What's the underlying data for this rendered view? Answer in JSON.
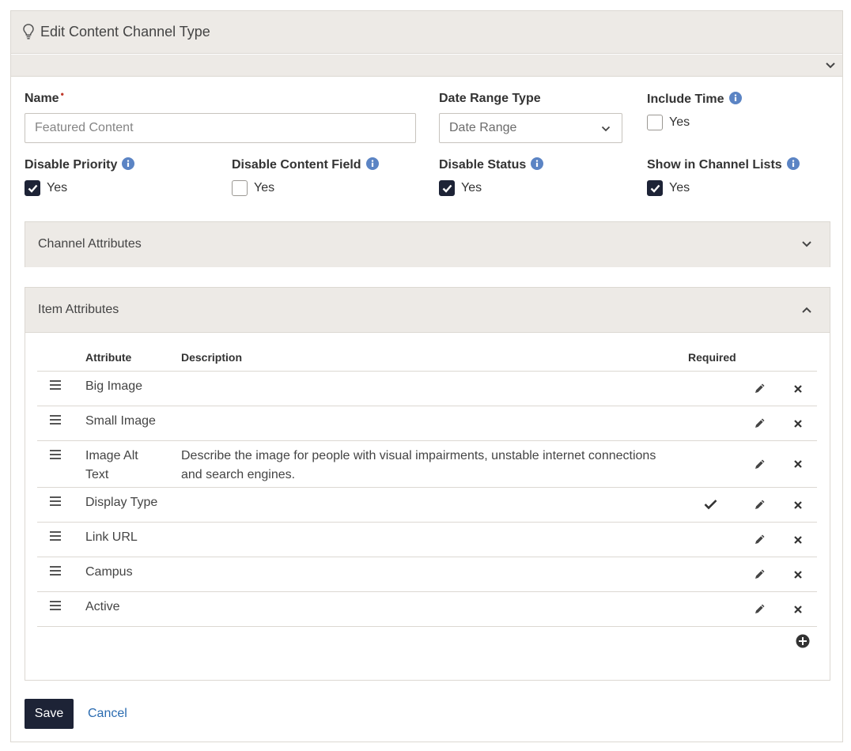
{
  "panel": {
    "title": "Edit Content Channel Type"
  },
  "form": {
    "name": {
      "label": "Name",
      "required_mark": "•",
      "value": "",
      "placeholder": "Featured Content"
    },
    "date_range_type": {
      "label": "Date Range Type",
      "selected": "Date Range"
    },
    "include_time": {
      "label": "Include Time",
      "option": "Yes",
      "checked": false
    },
    "disable_priority": {
      "label": "Disable Priority",
      "option": "Yes",
      "checked": true
    },
    "disable_content_field": {
      "label": "Disable Content Field",
      "option": "Yes",
      "checked": false
    },
    "disable_status": {
      "label": "Disable Status",
      "option": "Yes",
      "checked": true
    },
    "show_in_channel_lists": {
      "label": "Show in Channel Lists",
      "option": "Yes",
      "checked": true
    }
  },
  "channel_attributes": {
    "title": "Channel Attributes",
    "expanded": false
  },
  "item_attributes": {
    "title": "Item Attributes",
    "expanded": true,
    "columns": {
      "attribute": "Attribute",
      "description": "Description",
      "required": "Required"
    },
    "rows": [
      {
        "attribute": "Big Image",
        "description": "",
        "required": false
      },
      {
        "attribute": "Small Image",
        "description": "",
        "required": false
      },
      {
        "attribute": "Image Alt Text",
        "description": "Describe the image for people with visual impairments, unstable internet connections and search engines.",
        "required": false
      },
      {
        "attribute": "Display Type",
        "description": "",
        "required": true
      },
      {
        "attribute": "Link URL",
        "description": "",
        "required": false
      },
      {
        "attribute": "Campus",
        "description": "",
        "required": false
      },
      {
        "attribute": "Active",
        "description": "",
        "required": false
      }
    ]
  },
  "actions": {
    "save": "Save",
    "cancel": "Cancel"
  },
  "icons": {
    "header": "lightbulb-icon",
    "info": "info-circle-icon",
    "drag": "bars-icon",
    "edit": "pencil-icon",
    "delete": "times-icon",
    "required": "check-icon",
    "add": "plus-circle-icon"
  },
  "colors": {
    "primary": "#1d2336",
    "info": "#5b84c4",
    "link": "#2a6bb0",
    "header_bg": "#edeae6",
    "required": "#c0392b"
  }
}
